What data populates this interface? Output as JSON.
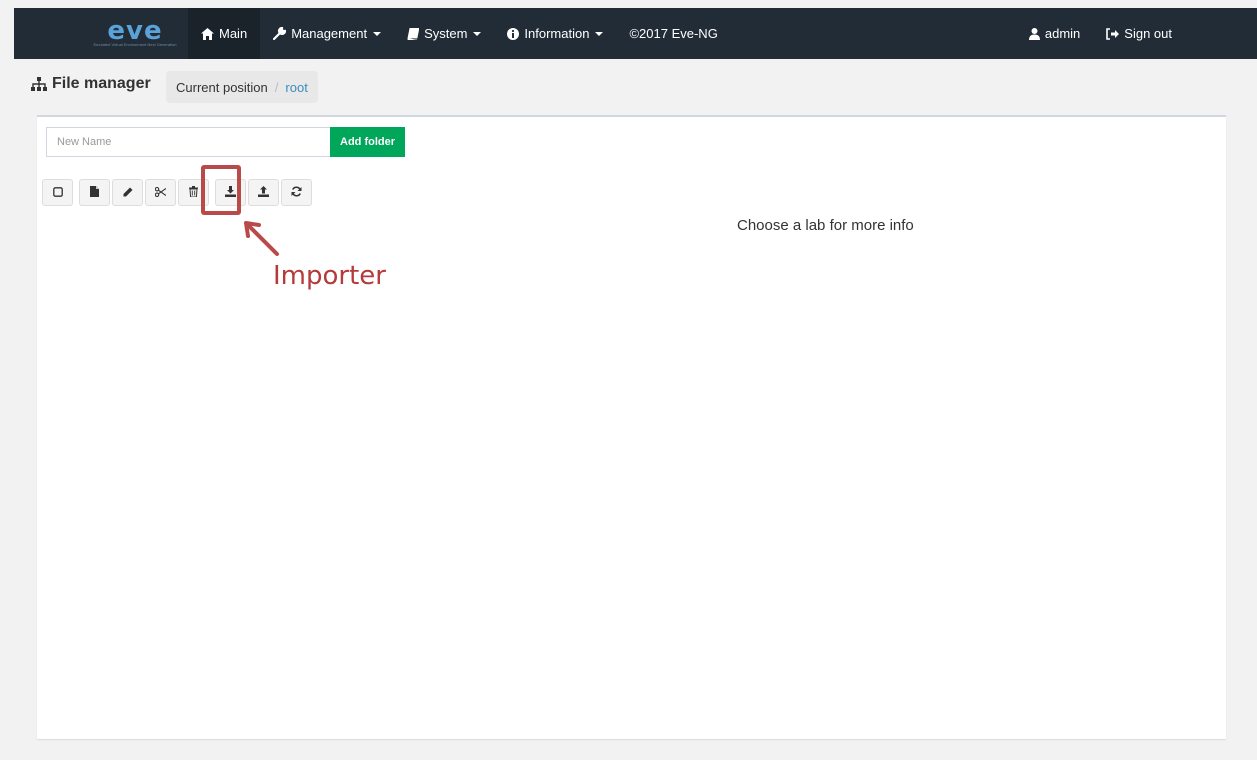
{
  "navbar": {
    "logo_text": "eve",
    "logo_subtext": "Emulated Virtual Environment Next Generation",
    "items": [
      {
        "label": "Main",
        "icon": "home-icon",
        "dropdown": false
      },
      {
        "label": "Management",
        "icon": "wrench-icon",
        "dropdown": true
      },
      {
        "label": "System",
        "icon": "book-icon",
        "dropdown": true
      },
      {
        "label": "Information",
        "icon": "info-circle-icon",
        "dropdown": true
      },
      {
        "label": "©2017 Eve-NG",
        "icon": "",
        "dropdown": false
      }
    ],
    "user": {
      "label": "admin",
      "icon": "user-icon"
    },
    "signout": {
      "label": "Sign out",
      "icon": "sign-out-icon"
    }
  },
  "header": {
    "title": "File manager",
    "title_icon": "sitemap-icon",
    "breadcrumb": {
      "label": "Current position",
      "separator": "/",
      "current": "root"
    }
  },
  "panel": {
    "new_name_placeholder": "New Name",
    "new_name_value": "",
    "add_folder_label": "Add folder",
    "toolbar": [
      {
        "name": "select-all-button",
        "icon": "checkbox-icon"
      },
      {
        "name": "new-lab-button",
        "icon": "file-icon"
      },
      {
        "name": "rename-button",
        "icon": "pencil-icon"
      },
      {
        "name": "move-button",
        "icon": "scissors-icon"
      },
      {
        "name": "delete-button",
        "icon": "trash-icon"
      },
      {
        "name": "import-button",
        "icon": "download-icon"
      },
      {
        "name": "export-button",
        "icon": "upload-icon"
      },
      {
        "name": "refresh-button",
        "icon": "refresh-icon"
      }
    ],
    "info_text": "Choose a lab for more info"
  },
  "annotation": {
    "label": "Importer",
    "color": "#b53a3a"
  },
  "colors": {
    "navbar_bg": "#222c36",
    "accent_blue": "#3c8dbc",
    "add_green": "#00a65a"
  }
}
